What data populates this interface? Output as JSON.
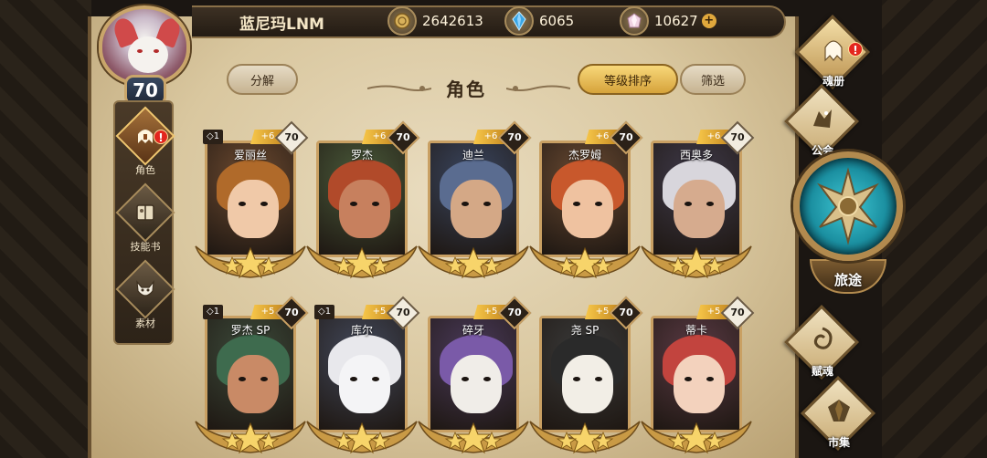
{
  "player": {
    "name": "蓝尼玛LNM",
    "level": "70"
  },
  "currencies": [
    {
      "name": "gold-coin-icon",
      "value": "2642613",
      "color": "#c9a04a"
    },
    {
      "name": "blue-crystal-icon",
      "value": "6065",
      "color": "#3aa7e6"
    },
    {
      "name": "pink-gem-icon",
      "value": "10627",
      "color": "#e8b8d0",
      "plus": "+"
    }
  ],
  "side_menu": [
    {
      "label": "角色",
      "icon": "helmet-icon",
      "active": true,
      "alert": "!"
    },
    {
      "label": "技能书",
      "icon": "skill-book-icon",
      "active": false
    },
    {
      "label": "素材",
      "icon": "wolf-material-icon",
      "active": false
    }
  ],
  "panel": {
    "title": "角色",
    "decompose_label": "分解",
    "sort_label": "等级排序",
    "filter_label": "筛选"
  },
  "cards": [
    {
      "name": "爱丽丝",
      "rank": "◇1",
      "plus": "+6",
      "level": "70",
      "dark_level": false
    },
    {
      "name": "罗杰",
      "rank": "",
      "plus": "+6",
      "level": "70",
      "dark_level": true
    },
    {
      "name": "迪兰",
      "rank": "",
      "plus": "+6",
      "level": "70",
      "dark_level": true
    },
    {
      "name": "杰罗姆",
      "rank": "",
      "plus": "+6",
      "level": "70",
      "dark_level": true
    },
    {
      "name": "西奥多",
      "rank": "",
      "plus": "+6",
      "level": "70",
      "dark_level": false
    },
    {
      "name": "罗杰 SP",
      "rank": "◇1",
      "plus": "+5",
      "level": "70",
      "dark_level": true
    },
    {
      "name": "库尔",
      "rank": "◇1",
      "plus": "+5",
      "level": "70",
      "dark_level": false
    },
    {
      "name": "碎牙",
      "rank": "",
      "plus": "+5",
      "level": "70",
      "dark_level": true
    },
    {
      "name": "尧 SP",
      "rank": "",
      "plus": "+5",
      "level": "70",
      "dark_level": true
    },
    {
      "name": "蒂卡",
      "rank": "",
      "plus": "+5",
      "level": "70",
      "dark_level": false
    }
  ],
  "right_menu": {
    "soul_book": {
      "label": "魂册",
      "alert": "!"
    },
    "guild": {
      "label": "公会"
    },
    "journey": {
      "label": "旅途"
    },
    "endow_soul": {
      "label": "赋魂"
    },
    "market": {
      "label": "市集"
    }
  }
}
